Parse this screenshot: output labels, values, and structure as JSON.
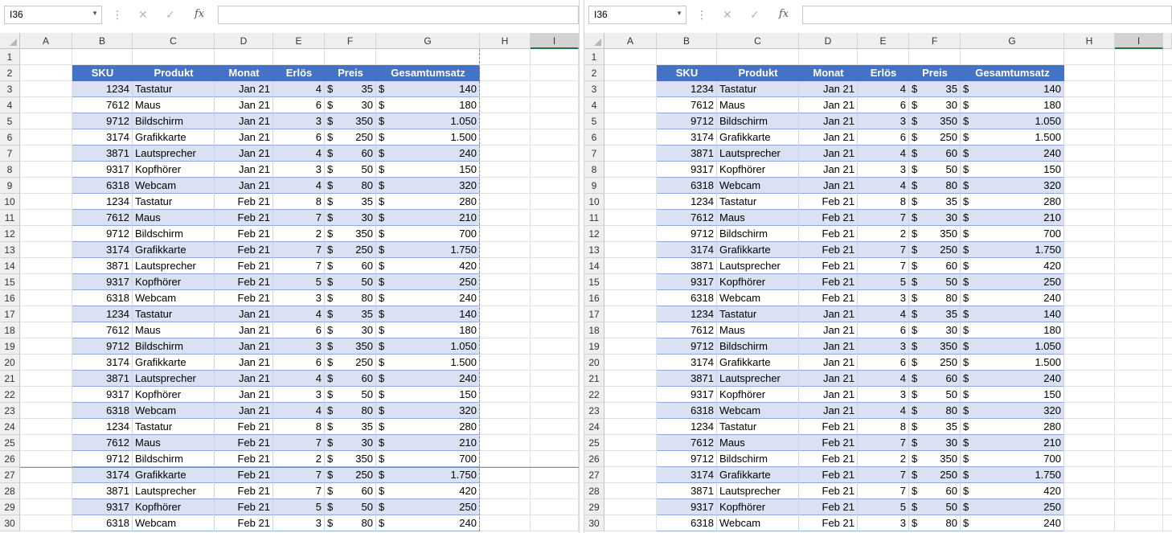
{
  "namebox": "I36",
  "columns": [
    "A",
    "B",
    "C",
    "D",
    "E",
    "F",
    "G",
    "H",
    "I"
  ],
  "header": {
    "sku": "SKU",
    "produkt": "Produkt",
    "monat": "Monat",
    "erloes": "Erlös",
    "preis": "Preis",
    "gesamt": "Gesamtumsatz"
  },
  "currency_symbol": "$",
  "rows": [
    {
      "sku": "1234",
      "produkt": "Tastatur",
      "monat": "Jan 21",
      "erloes": "4",
      "preis": "35",
      "gesamt": "140"
    },
    {
      "sku": "7612",
      "produkt": "Maus",
      "monat": "Jan 21",
      "erloes": "6",
      "preis": "30",
      "gesamt": "180"
    },
    {
      "sku": "9712",
      "produkt": "Bildschirm",
      "monat": "Jan 21",
      "erloes": "3",
      "preis": "350",
      "gesamt": "1.050"
    },
    {
      "sku": "3174",
      "produkt": "Grafikkarte",
      "monat": "Jan 21",
      "erloes": "6",
      "preis": "250",
      "gesamt": "1.500"
    },
    {
      "sku": "3871",
      "produkt": "Lautsprecher",
      "monat": "Jan 21",
      "erloes": "4",
      "preis": "60",
      "gesamt": "240"
    },
    {
      "sku": "9317",
      "produkt": "Kopfhörer",
      "monat": "Jan 21",
      "erloes": "3",
      "preis": "50",
      "gesamt": "150"
    },
    {
      "sku": "6318",
      "produkt": "Webcam",
      "monat": "Jan 21",
      "erloes": "4",
      "preis": "80",
      "gesamt": "320"
    },
    {
      "sku": "1234",
      "produkt": "Tastatur",
      "monat": "Feb 21",
      "erloes": "8",
      "preis": "35",
      "gesamt": "280"
    },
    {
      "sku": "7612",
      "produkt": "Maus",
      "monat": "Feb 21",
      "erloes": "7",
      "preis": "30",
      "gesamt": "210"
    },
    {
      "sku": "9712",
      "produkt": "Bildschirm",
      "monat": "Feb 21",
      "erloes": "2",
      "preis": "350",
      "gesamt": "700"
    },
    {
      "sku": "3174",
      "produkt": "Grafikkarte",
      "monat": "Feb 21",
      "erloes": "7",
      "preis": "250",
      "gesamt": "1.750"
    },
    {
      "sku": "3871",
      "produkt": "Lautsprecher",
      "monat": "Feb 21",
      "erloes": "7",
      "preis": "60",
      "gesamt": "420"
    },
    {
      "sku": "9317",
      "produkt": "Kopfhörer",
      "monat": "Feb 21",
      "erloes": "5",
      "preis": "50",
      "gesamt": "250"
    },
    {
      "sku": "6318",
      "produkt": "Webcam",
      "monat": "Feb 21",
      "erloes": "3",
      "preis": "80",
      "gesamt": "240"
    },
    {
      "sku": "1234",
      "produkt": "Tastatur",
      "monat": "Jan 21",
      "erloes": "4",
      "preis": "35",
      "gesamt": "140"
    },
    {
      "sku": "7612",
      "produkt": "Maus",
      "monat": "Jan 21",
      "erloes": "6",
      "preis": "30",
      "gesamt": "180"
    },
    {
      "sku": "9712",
      "produkt": "Bildschirm",
      "monat": "Jan 21",
      "erloes": "3",
      "preis": "350",
      "gesamt": "1.050"
    },
    {
      "sku": "3174",
      "produkt": "Grafikkarte",
      "monat": "Jan 21",
      "erloes": "6",
      "preis": "250",
      "gesamt": "1.500"
    },
    {
      "sku": "3871",
      "produkt": "Lautsprecher",
      "monat": "Jan 21",
      "erloes": "4",
      "preis": "60",
      "gesamt": "240"
    },
    {
      "sku": "9317",
      "produkt": "Kopfhörer",
      "monat": "Jan 21",
      "erloes": "3",
      "preis": "50",
      "gesamt": "150"
    },
    {
      "sku": "6318",
      "produkt": "Webcam",
      "monat": "Jan 21",
      "erloes": "4",
      "preis": "80",
      "gesamt": "320"
    },
    {
      "sku": "1234",
      "produkt": "Tastatur",
      "monat": "Feb 21",
      "erloes": "8",
      "preis": "35",
      "gesamt": "280"
    },
    {
      "sku": "7612",
      "produkt": "Maus",
      "monat": "Feb 21",
      "erloes": "7",
      "preis": "30",
      "gesamt": "210"
    },
    {
      "sku": "9712",
      "produkt": "Bildschirm",
      "monat": "Feb 21",
      "erloes": "2",
      "preis": "350",
      "gesamt": "700"
    },
    {
      "sku": "3174",
      "produkt": "Grafikkarte",
      "monat": "Feb 21",
      "erloes": "7",
      "preis": "250",
      "gesamt": "1.750"
    },
    {
      "sku": "3871",
      "produkt": "Lautsprecher",
      "monat": "Feb 21",
      "erloes": "7",
      "preis": "60",
      "gesamt": "420"
    },
    {
      "sku": "9317",
      "produkt": "Kopfhörer",
      "monat": "Feb 21",
      "erloes": "5",
      "preis": "50",
      "gesamt": "250"
    },
    {
      "sku": "6318",
      "produkt": "Webcam",
      "monat": "Feb 21",
      "erloes": "3",
      "preis": "80",
      "gesamt": "240"
    }
  ],
  "colors": {
    "header_fill": "#4472c4",
    "band_fill": "#d9e1f2",
    "selected_col_accent": "#217346"
  },
  "icons": {
    "cancel": "x-icon",
    "enter": "check-icon",
    "function": "fx-icon"
  }
}
